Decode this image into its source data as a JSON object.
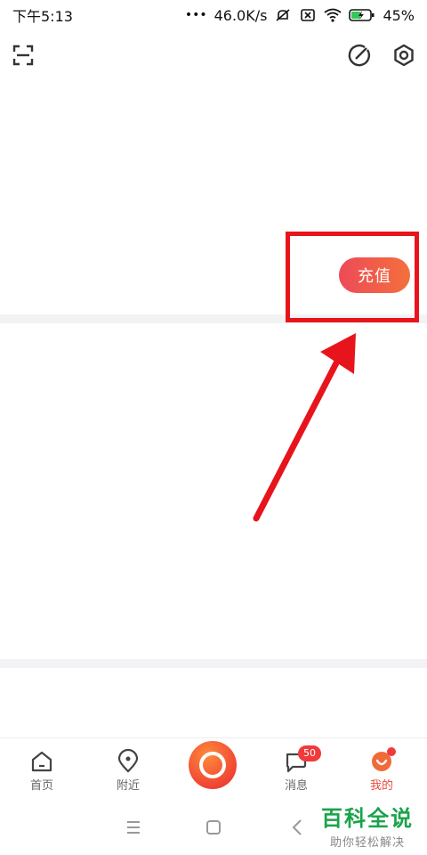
{
  "status_bar": {
    "time": "下午5:13",
    "network_speed": "46.0K/s",
    "battery": "45%"
  },
  "top_toolbar": {
    "scan_icon": "scan-icon",
    "edit_icon": "edit-icon",
    "settings_icon": "settings-gear-icon"
  },
  "main": {
    "recharge_label": "充值"
  },
  "annotation": {
    "box_color": "#e8141c",
    "arrow_color": "#e8141c"
  },
  "bottom_nav": {
    "items": [
      {
        "label": "首页",
        "icon": "home-icon"
      },
      {
        "label": "附近",
        "icon": "location-pin-icon"
      },
      {
        "label": "",
        "icon": "record-button-icon"
      },
      {
        "label": "消息",
        "icon": "message-bubble-icon",
        "badge": "50"
      },
      {
        "label": "我的",
        "icon": "profile-icon"
      }
    ],
    "active_color": "#e84c3d"
  },
  "watermark": {
    "title": "百科全说",
    "subtitle": "助你轻松解决"
  }
}
